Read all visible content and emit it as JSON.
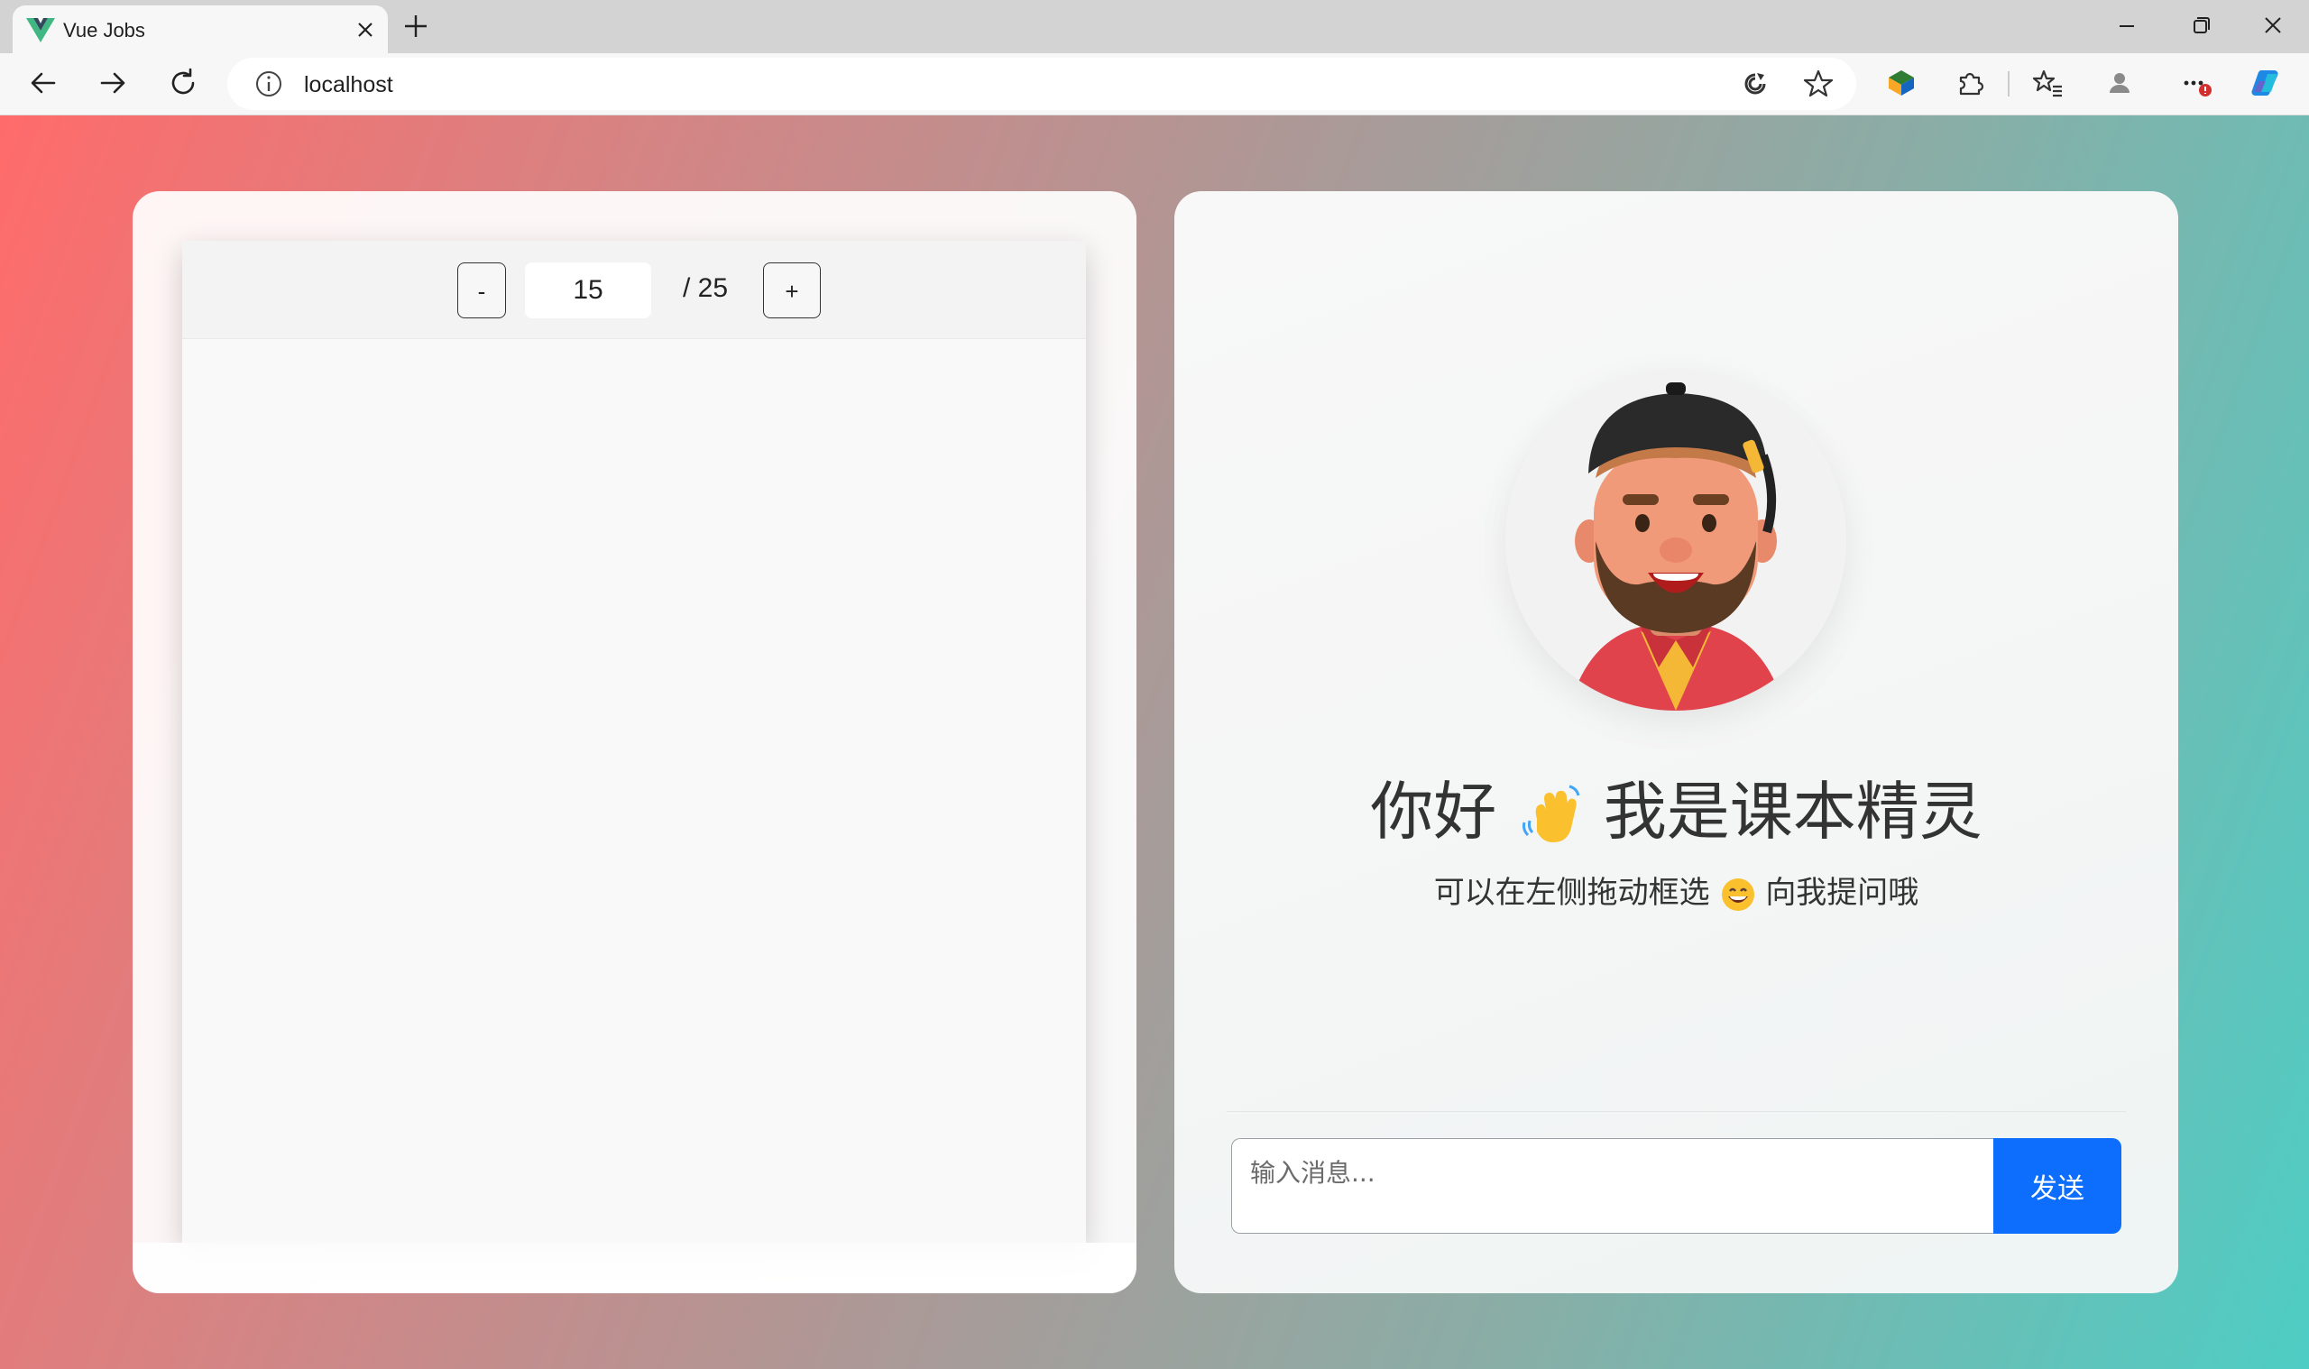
{
  "browser": {
    "tab_title": "Vue Jobs",
    "address": "localhost"
  },
  "pdf_viewer": {
    "prev_label": "-",
    "next_label": "+",
    "current_page": "15",
    "total_label": "/ 25"
  },
  "assistant": {
    "greeting_before": "你好",
    "greeting_after": "我是课本精灵",
    "subtitle_before": "可以在左侧拖动框选",
    "subtitle_after": "向我提问哦",
    "input_placeholder": "输入消息...",
    "send_label": "发送"
  },
  "icons": {
    "tab_logo": "vue-logo-icon",
    "tab_close": "close-icon",
    "new_tab": "plus-icon",
    "back": "arrow-left-icon",
    "forward": "arrow-right-icon",
    "reload": "refresh-icon",
    "site_info": "info-icon",
    "read_aloud": "read-aloud-icon",
    "favorite": "star-icon",
    "extension": "puzzle-icon",
    "favorites": "favorites-icon",
    "profile": "user-icon",
    "menu": "more-icon",
    "copilot": "copilot-icon",
    "wave": "waving-hand-emoji",
    "smile": "grinning-emoji"
  },
  "colors": {
    "gradient_left": "#ff6b6b",
    "gradient_right": "#4ecdc4",
    "send_button": "#0d6efd"
  }
}
